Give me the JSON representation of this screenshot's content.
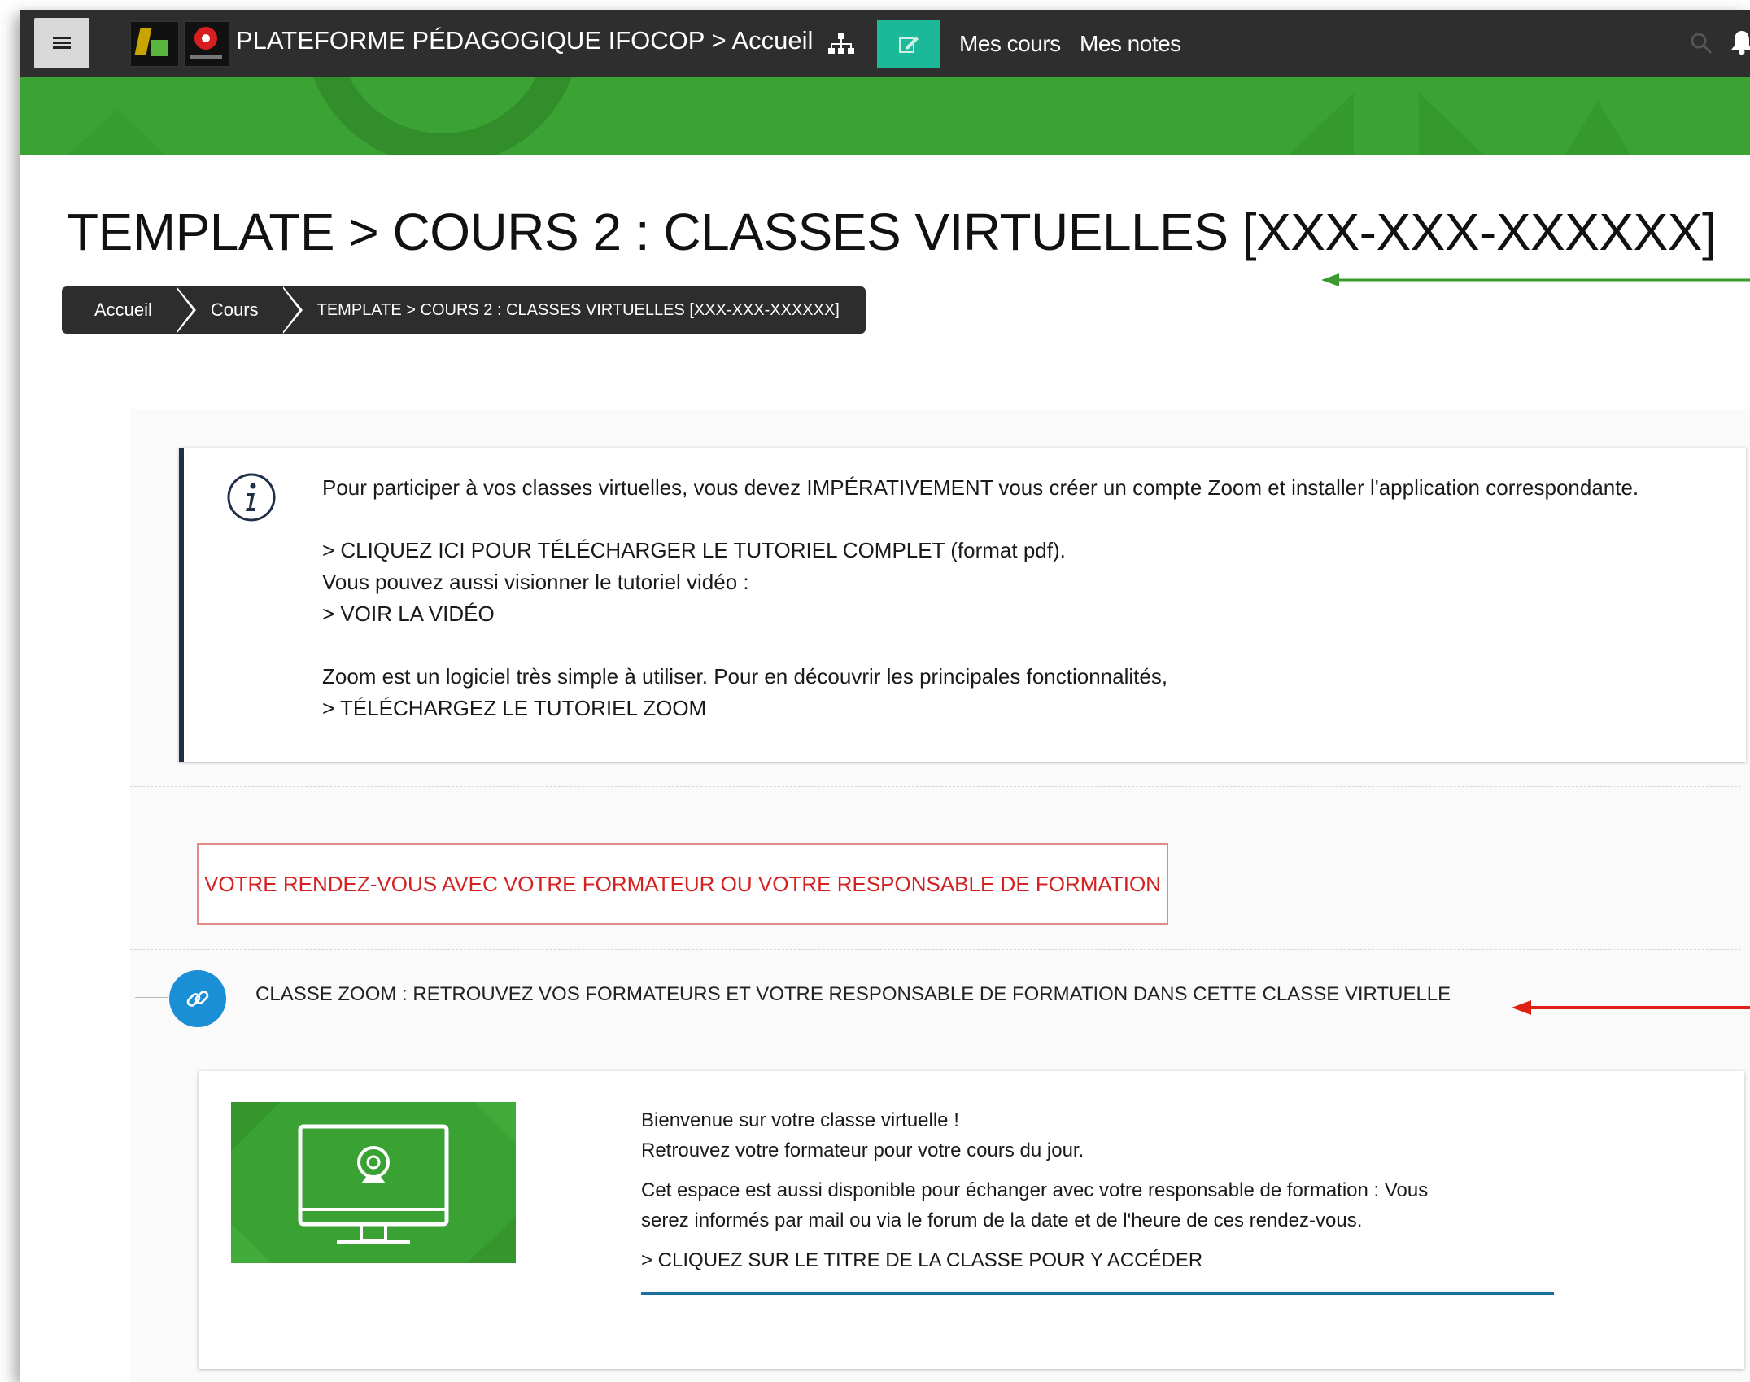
{
  "navbar": {
    "site_title": "PLATEFORME PÉDAGOGIQUE IFOCOP > Accueil",
    "links": [
      "Mes cours",
      "Mes notes"
    ]
  },
  "page": {
    "title": "TEMPLATE > COURS 2 : CLASSES VIRTUELLES [XXX-XXX-XXXXXX]",
    "breadcrumb": [
      "Accueil",
      "Cours",
      "TEMPLATE > COURS 2 : CLASSES VIRTUELLES [XXX-XXX-XXXXXX]"
    ]
  },
  "info_box": {
    "line1": "Pour participer à vos classes virtuelles, vous devez IMPÉRATIVEMENT vous créer un compte Zoom et installer l'application correspondante.",
    "tutorial_link": "> CLIQUEZ ICI POUR TÉLÉCHARGER LE TUTORIEL COMPLET",
    "tutorial_format": " (format pdf).",
    "video_intro": "Vous pouvez aussi visionner le tutoriel vidéo :",
    "video_link": "> VOIR LA VIDÉO",
    "zoom_intro": "Zoom est un logiciel très simple à utiliser. Pour en découvrir les principales fonctionnalités,",
    "zoom_link": "> TÉLÉCHARGEZ LE TUTORIEL ZOOM"
  },
  "rdv_label": "VOTRE RENDEZ-VOUS AVEC VOTRE FORMATEUR OU VOTRE RESPONSABLE DE FORMATION",
  "zoom_activity": {
    "title": "CLASSE ZOOM : RETROUVEZ VOS FORMATEURS ET VOTRE RESPONSABLE DE FORMATION DANS CETTE CLASSE VIRTUELLE"
  },
  "card": {
    "line1": "Bienvenue sur votre classe virtuelle !",
    "line2": "Retrouvez votre formateur pour votre cours du jour.",
    "line3": "Cet espace est aussi disponible pour échanger avec votre responsable de formation : Vous",
    "line4": "serez informés par mail ou via le forum de la date et de l'heure de ces rendez-vous.",
    "link": "> CLIQUEZ SUR LE TITRE DE LA CLASSE POUR Y ACCÉDER"
  },
  "colors": {
    "navbar": "#2e2e2e",
    "banner_green": "#3ba234",
    "edit_teal": "#1bb89a",
    "rdv_red": "#d42222",
    "link_blue": "#1a8fd6",
    "arrow_green": "#3a9a2e",
    "arrow_red": "#e02010"
  },
  "icons": [
    "menu-icon",
    "sitemap-icon",
    "edit-icon",
    "search-icon",
    "bell-icon",
    "info-icon",
    "link-icon",
    "webcam-monitor-icon"
  ]
}
